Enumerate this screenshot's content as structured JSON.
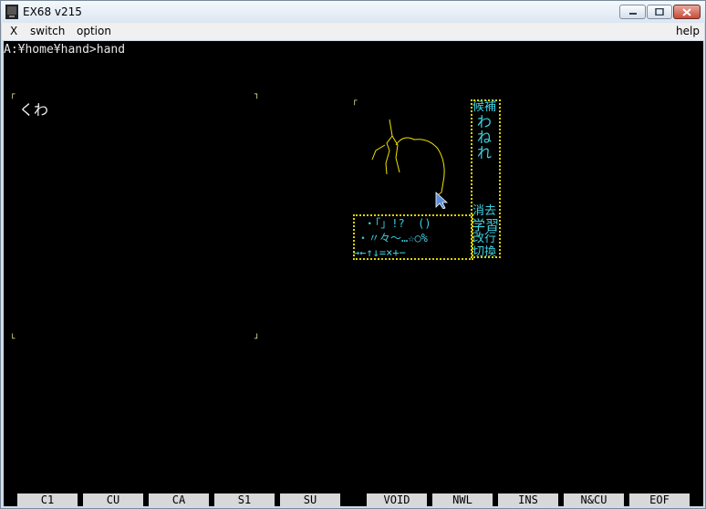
{
  "window": {
    "title": "EX68 v215"
  },
  "menu": {
    "x": "X",
    "switch": "switch",
    "option": "option",
    "help": "help"
  },
  "terminal": {
    "prompt": "A:¥home¥hand>hand",
    "input_kana": "くわ"
  },
  "candidates": {
    "label": "候補",
    "items": [
      "わ",
      "ね",
      "れ"
    ]
  },
  "pad_buttons": {
    "clear": "消去",
    "learn": "学習",
    "newline": "改行",
    "switch": "切換"
  },
  "symbols": {
    "row1": " ・「」!?  ()",
    "row2": "・〃々〜…☆○%",
    "row3": "→←↑↓=×+−"
  },
  "fkeys": [
    "C1",
    "CU",
    "CA",
    "S1",
    "SU",
    "VOID",
    "NWL",
    "INS",
    "N&CU",
    "EOF"
  ],
  "colors": {
    "screen_bg": "#000000",
    "pad_border": "#e0d300",
    "candidate": "#3ed0e0",
    "stroke": "#f2e200"
  }
}
